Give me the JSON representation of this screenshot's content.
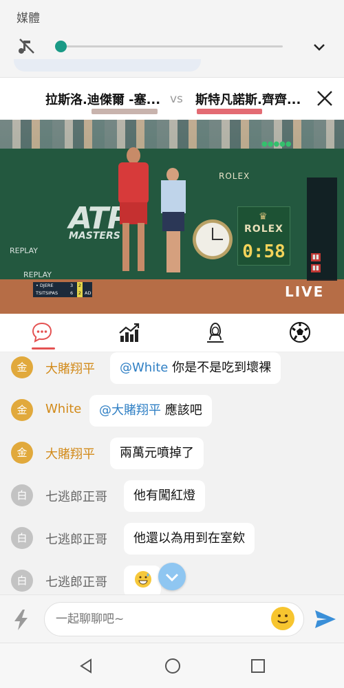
{
  "media": {
    "title": "媒體",
    "progress_percent": 1
  },
  "match": {
    "team_a": "拉斯洛.迪傑爾 -塞...",
    "vs": "vs",
    "team_b": "斯特凡諾斯.齊齊...",
    "colors": {
      "team_a_bar": "#c8b3ad",
      "team_b_bar": "#e36b73"
    }
  },
  "video": {
    "rolex_wall": "ROLEX",
    "rolex_board": "ROLEX",
    "clock_time": "0:58",
    "atp": "ATP",
    "masters": "MASTERS",
    "replay_1": "REPLAY",
    "replay_2": "REPLAY",
    "live": "LIVE",
    "scoreboard": [
      {
        "name": "• DJERE",
        "set": "3",
        "games": "2",
        "points": ""
      },
      {
        "name": "TSITSIPAS",
        "set": "6",
        "games": "2",
        "points": "AD"
      }
    ]
  },
  "tabs": [
    {
      "name": "chat-icon",
      "active": true
    },
    {
      "name": "stats-chart-icon",
      "active": false
    },
    {
      "name": "player-icon",
      "active": false
    },
    {
      "name": "soccer-ball-icon",
      "active": false
    }
  ],
  "chat": {
    "messages": [
      {
        "badge": "金",
        "user": "大賭翔平",
        "mention": "@White",
        "text": " 你是不是吃到壞裸"
      },
      {
        "badge": "金",
        "user": "White",
        "mention": "@大賭翔平",
        "text": " 應該吧"
      },
      {
        "badge": "金",
        "user": "大賭翔平",
        "mention": "",
        "text": "兩萬元噴掉了"
      },
      {
        "badge": "白",
        "user": "七逃郎正哥",
        "mention": "",
        "text": "他有闖紅燈"
      },
      {
        "badge": "白",
        "user": "七逃郎正哥",
        "mention": "",
        "text": "他還以為用到在室欸"
      },
      {
        "badge": "白",
        "user": "七逃郎正哥",
        "mention": "",
        "text": "",
        "emoji": "grin-sweat-icon"
      }
    ]
  },
  "input": {
    "placeholder": "一起聊聊吧~"
  },
  "colors": {
    "accent": "#e45252",
    "gold": "#d28a19",
    "mention": "#2f7fc4",
    "send": "#3a8fd8",
    "teal": "#1a9a86"
  }
}
